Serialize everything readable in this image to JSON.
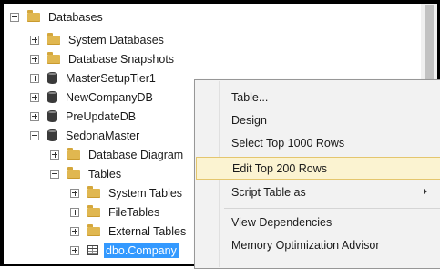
{
  "tree": {
    "databases": "Databases",
    "system_databases": "System Databases",
    "database_snapshots": "Database Snapshots",
    "master_setup": "MasterSetupTier1",
    "new_company": "NewCompanyDB",
    "pre_update": "PreUpdateDB",
    "sedona_master": "SedonaMaster",
    "database_diagrams": "Database Diagram",
    "tables": "Tables",
    "system_tables": "System Tables",
    "file_tables": "FileTables",
    "external_tables": "External Tables",
    "selected_table": "dbo.Company"
  },
  "context_menu": {
    "items": [
      "Table...",
      "Design",
      "Select Top 1000 Rows",
      "Edit Top 200 Rows",
      "Script Table as",
      "View Dependencies",
      "Memory Optimization Advisor"
    ],
    "highlighted": "Edit Top 200 Rows"
  }
}
